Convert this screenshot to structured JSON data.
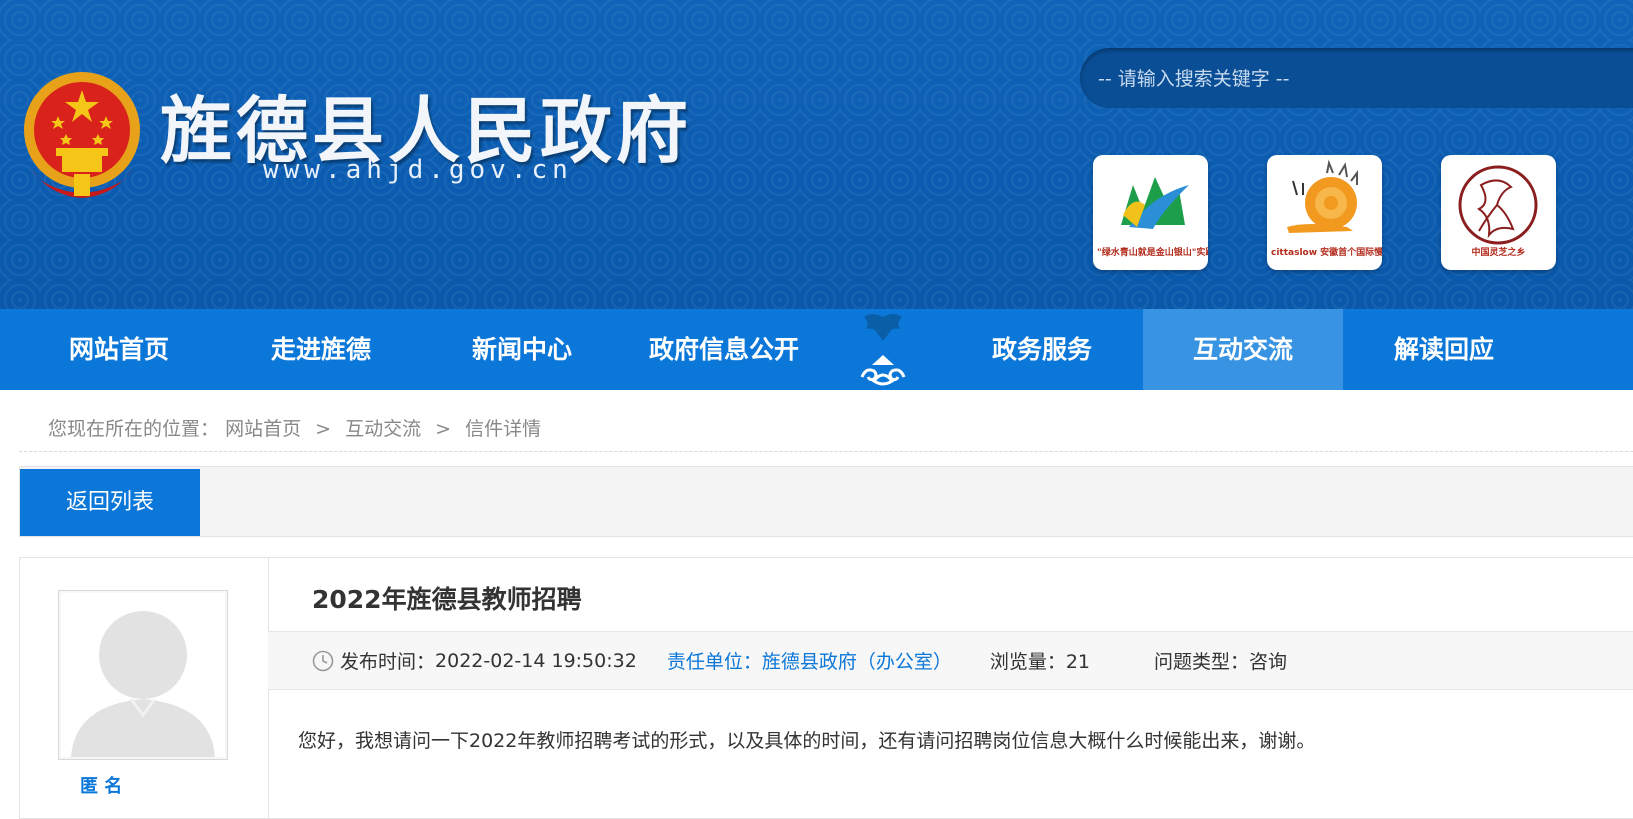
{
  "header": {
    "site_name": "旌德县人民政府",
    "site_url": "www.ahjd.gov.cn",
    "search_placeholder": "-- 请输入搜索关键字 --",
    "badges": [
      {
        "caption": "\"绿水青山就是金山银山\"实践创新基地"
      },
      {
        "caption": "cittaslow 安徽首个国际慢城"
      },
      {
        "caption": "中国灵芝之乡"
      }
    ]
  },
  "nav": {
    "items": [
      "网站首页",
      "走进旌德",
      "新闻中心",
      "政府信息公开",
      "政务服务",
      "互动交流",
      "解读回应"
    ],
    "active": "互动交流"
  },
  "breadcrumb": {
    "prefix": "您现在所在的位置：",
    "items": [
      "网站首页",
      "互动交流",
      "信件详情"
    ],
    "separator": ">"
  },
  "toolbar": {
    "back_label": "返回列表"
  },
  "letter": {
    "author": "匿  名",
    "title": "2022年旌德县教师招聘",
    "publish_label": "发布时间：",
    "publish_time": "2022-02-14 19:50:32",
    "dept": "责任单位：旌德县政府（办公室）",
    "views": "浏览量：21",
    "type": "问题类型：咨询",
    "content": "您好，我想请问一下2022年教师招聘考试的形式，以及具体的时间，还有请问招聘岗位信息大概什么时候能出来，谢谢。"
  },
  "colors": {
    "header_bg": "#0b5cb0",
    "nav_bg": "#0b77d9",
    "nav_active": "#3893e2",
    "accent": "#0b77d9"
  }
}
